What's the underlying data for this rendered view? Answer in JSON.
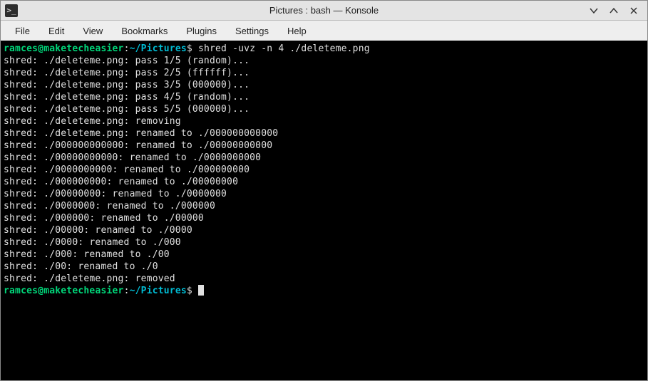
{
  "window": {
    "title": "Pictures : bash — Konsole",
    "icon_glyph": ">_"
  },
  "menu": {
    "items": [
      "File",
      "Edit",
      "View",
      "Bookmarks",
      "Plugins",
      "Settings",
      "Help"
    ]
  },
  "prompt": {
    "user": "ramces",
    "at": "@",
    "host": "maketecheasier",
    "colon": ":",
    "path": "~/Pictures",
    "symbol": "$"
  },
  "terminal": {
    "command": "shred -uvz -n 4 ./deleteme.png",
    "output": [
      "shred: ./deleteme.png: pass 1/5 (random)...",
      "shred: ./deleteme.png: pass 2/5 (ffffff)...",
      "shred: ./deleteme.png: pass 3/5 (000000)...",
      "shred: ./deleteme.png: pass 4/5 (random)...",
      "shred: ./deleteme.png: pass 5/5 (000000)...",
      "shred: ./deleteme.png: removing",
      "shred: ./deleteme.png: renamed to ./000000000000",
      "shred: ./000000000000: renamed to ./00000000000",
      "shred: ./00000000000: renamed to ./0000000000",
      "shred: ./0000000000: renamed to ./000000000",
      "shred: ./000000000: renamed to ./00000000",
      "shred: ./00000000: renamed to ./0000000",
      "shred: ./0000000: renamed to ./000000",
      "shred: ./000000: renamed to ./00000",
      "shred: ./00000: renamed to ./0000",
      "shred: ./0000: renamed to ./000",
      "shred: ./000: renamed to ./00",
      "shred: ./00: renamed to ./0",
      "shred: ./deleteme.png: removed"
    ]
  }
}
